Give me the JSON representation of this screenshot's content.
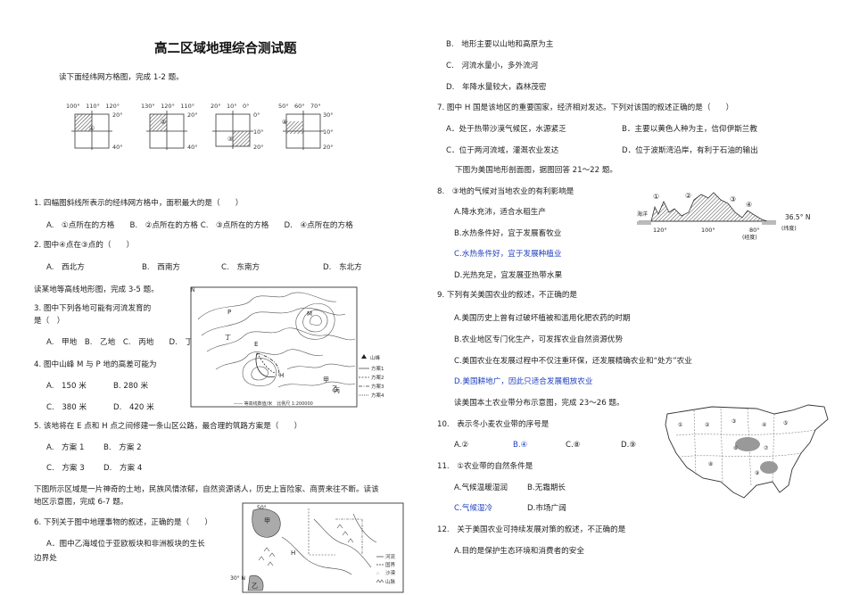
{
  "doc": {
    "title": "高二区域地理综合测试题",
    "intro1": "读下面经纬网方格图，完成 1-2 题。",
    "q1": "1. 四幅图斜线所表示的经纬网方格中，面积最大的是（　　）",
    "q1opts": "A.　①点所在的方格　　B.　②点所在的方格 C.　③点所在的方格　　D.　④点所在的方格",
    "q2": "2. 图中④点在③点的（　　）",
    "q2a": "A.　西北方",
    "q2b": "B.　西南方",
    "q2c": "C.　东南方",
    "q2d": "D.　东北方",
    "intro2": "读某地等高线地形图，完成 3-5 题。",
    "q3a": "3. 图中下列各地可能有河流发育的",
    "q3b": "是（　）",
    "q3opts": "A.　甲地　B.　乙地　C.　丙地　　D.　丁地",
    "q4": "4. 图中山峰 M 与 P 地的高差可能为",
    "q4a": "A.　150 米",
    "q4b": "B. 280 米",
    "q4c": "C.　380 米",
    "q4d": "D.　420 米",
    "q5": "5. 该地将在 E 点和 H 点之间修建一条山区公路，最合理的筑路方案是（　　）",
    "q5a": "A.　方案 1",
    "q5b": "B.　方案 2",
    "q5c": "C.　方案 3",
    "q5d": "D.　方案 4",
    "intro3a": "下图所示区域是一片神奇的土地，民族风情浓郁，自然资源诱人，历史上盲险家、商贾来往不断。读该",
    "intro3b": "地区示意图，完成 6-7 题。",
    "q6": "6. 下列关于图中地理事物的叙述，正确的是（　　）",
    "q6a1": "A．图中乙海域位于亚欧板块和非洲板块的生长",
    "q6a2": "边界处",
    "r1": "B.　地形主要以山地和高原为主",
    "r2": "C.　河流水量小，多外流河",
    "r3": "D.　年降水量较大，森林茂密",
    "q7": "7. 图中 H 国是该地区的重要国家，经济相对发达。下列对该国的叙述正确的是（　　）",
    "q7a": "A．处于热带沙漠气候区，水源紧乏",
    "q7b": "B．主要以黄色人种为主，信仰伊斯兰教",
    "q7c": "C．位于两河流域，灌溉农业发达",
    "q7d": "D．位于波斯湾沿岸，有利于石油的输出",
    "intro4": "下图为美国地形剖面图，据图回答 21～22 题。",
    "q8": "8.　③地的气候对当地农业的有利影响是",
    "q8a": "A.降水充沛，适合水稻生产",
    "q8b": "B.水热条件好，宜于发展畜牧业",
    "q8c": "C.水热条件好，宜于发展种植业",
    "q8d": "D.光热充足，宜发展亚热带水果",
    "q9": "9. 下列有关美国农业的叙述，不正确的是",
    "q9a": "A.美国历史上曾有过破坏植被和滥用化肥农药的时期",
    "q9b": "B.农业地区专门化生产，可发挥农业自然资源优势",
    "q9c": "C.美国农业在发展过程中不仅注重环保，还发展精确农业和“处方”农业",
    "q9d": "D.美国耕地广，因此只适合发展粗放农业",
    "intro5": "读美国本土农业带分布示意图，完成 23～26 题。",
    "q10": "10.　表示冬小麦农业带的序号是",
    "q10a": "A.②",
    "q10b": "B.④",
    "q10c": "C.⑧",
    "q10d": "D.⑨",
    "q11": "11.　①农业带的自然条件是",
    "q11a": "A.气候温暖湿润",
    "q11b": "B.无霜期长",
    "q11c": "C.气候湿冷",
    "q11d": "D.市场广阔",
    "q12": "12.　关于美国农业可持续发展对策的叙述，不正确的是",
    "q12a": "A.目的是保护生态环境和消费者的安全"
  },
  "grid_fig": {
    "g1": {
      "top": "100°　110°　120°",
      "r1": "20°",
      "r2": "40°",
      "mark": "①"
    },
    "g2": {
      "top": "130°　120°　110°",
      "r1": "20°",
      "r2": "40°",
      "mark": "②"
    },
    "g3": {
      "top": "20°　10°　0°",
      "r1": "0°",
      "r2": "10°",
      "r3": "20°",
      "mark": "③"
    },
    "g4": {
      "top": "50°　60°　70°",
      "r1": "30°",
      "r2": "10°",
      "r3": "20°",
      "mark": "④"
    }
  },
  "contour_fig": {
    "north": "N",
    "legend": [
      "山峰",
      "方案1",
      "方案2",
      "方案3",
      "方案4"
    ],
    "scale_note": "—— 等高线数值/米　比例尺 1:200000",
    "labels": [
      "M",
      "E",
      "H",
      "P",
      "甲",
      "乙",
      "丙",
      "丁"
    ]
  },
  "region_fig": {
    "lat1": "50°",
    "lat2": "30° N",
    "labels": {
      "jia": "甲",
      "yi": "乙",
      "h": "H"
    },
    "legend": [
      "河流",
      "国界",
      "沙漠",
      "山脉"
    ]
  },
  "profile_fig": {
    "marks": [
      "①",
      "②",
      "③",
      "④"
    ],
    "sea": "海洋",
    "lon1": "120°",
    "lon2": "100°",
    "lon3": "80°",
    "lon_label": "(经度)",
    "lat": "36.5° N",
    "lat_label": "(纬度)"
  }
}
